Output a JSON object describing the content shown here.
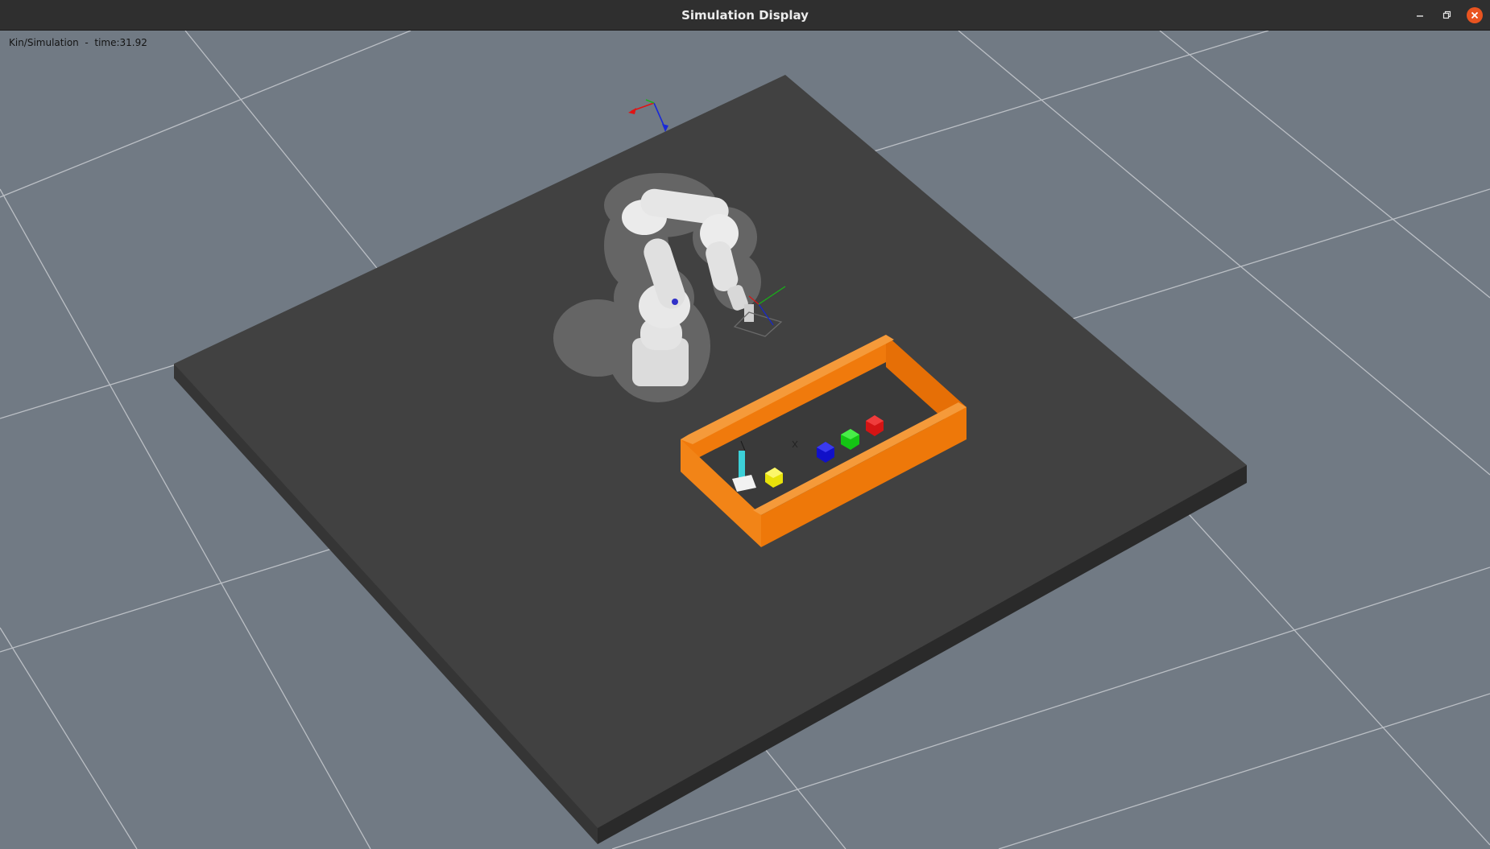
{
  "window": {
    "title": "Simulation Display",
    "controls": {
      "minimize_icon": "minimize-icon",
      "maximize_icon": "restore-icon",
      "close_icon": "close-icon"
    }
  },
  "viewport": {
    "status_text": "Kin/Simulation  -  time:31.92",
    "background_color": "#717a84",
    "grid_color": "#c8ccd1",
    "table_color": "#3f3f3f",
    "bin_color": "#f07a0c",
    "cubes": [
      {
        "name": "white",
        "color": "#f2f2f2"
      },
      {
        "name": "yellow",
        "color": "#f5ef12"
      },
      {
        "name": "blue",
        "color": "#1010d8"
      },
      {
        "name": "green",
        "color": "#18d418"
      },
      {
        "name": "red",
        "color": "#e01818"
      }
    ]
  }
}
